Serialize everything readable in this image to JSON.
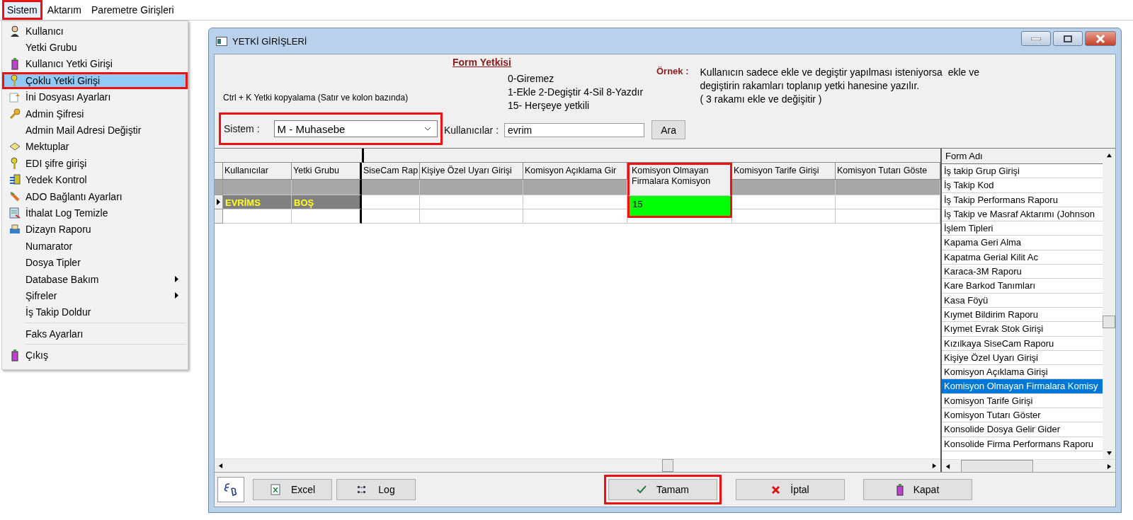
{
  "menubar": [
    {
      "label": "Sistem",
      "selected": true,
      "highlighted": true
    },
    {
      "label": "Aktarım",
      "selected": false,
      "highlighted": false
    },
    {
      "label": "Paremetre Girişleri",
      "selected": false,
      "highlighted": false
    }
  ],
  "menu": [
    {
      "kind": "item",
      "label": "Kullanıcı",
      "selected": false,
      "highlighted": false,
      "submenu": false
    },
    {
      "kind": "item",
      "label": "Yetki Grubu",
      "selected": false,
      "highlighted": false,
      "submenu": false
    },
    {
      "kind": "item",
      "label": "Kullanıcı Yetki Girişi",
      "selected": false,
      "highlighted": false,
      "submenu": false
    },
    {
      "kind": "item",
      "label": "Çoklu Yetki Girişi",
      "selected": true,
      "highlighted": true,
      "submenu": false
    },
    {
      "kind": "item",
      "label": "İni Dosyası  Ayarları",
      "selected": false,
      "highlighted": false,
      "submenu": false
    },
    {
      "kind": "item",
      "label": "Admin Şifresi",
      "selected": false,
      "highlighted": false,
      "submenu": false
    },
    {
      "kind": "item",
      "label": "Admin Mail Adresi Değiştir",
      "selected": false,
      "highlighted": false,
      "submenu": false
    },
    {
      "kind": "item",
      "label": "Mektuplar",
      "selected": false,
      "highlighted": false,
      "submenu": false
    },
    {
      "kind": "item",
      "label": "EDI şifre girişi",
      "selected": false,
      "highlighted": false,
      "submenu": false
    },
    {
      "kind": "item",
      "label": "Yedek Kontrol",
      "selected": false,
      "highlighted": false,
      "submenu": false
    },
    {
      "kind": "item",
      "label": "ADO Bağlantı Ayarları",
      "selected": false,
      "highlighted": false,
      "submenu": false
    },
    {
      "kind": "item",
      "label": "İthalat Log Temizle",
      "selected": false,
      "highlighted": false,
      "submenu": false
    },
    {
      "kind": "item",
      "label": "Dizayn Raporu",
      "selected": false,
      "highlighted": false,
      "submenu": false
    },
    {
      "kind": "item",
      "label": "Numarator",
      "selected": false,
      "highlighted": false,
      "submenu": false
    },
    {
      "kind": "item",
      "label": "Dosya Tipler",
      "selected": false,
      "highlighted": false,
      "submenu": false
    },
    {
      "kind": "item",
      "label": "Database Bakım",
      "selected": false,
      "highlighted": false,
      "submenu": true
    },
    {
      "kind": "item",
      "label": "Şifreler",
      "selected": false,
      "highlighted": false,
      "submenu": true
    },
    {
      "kind": "item",
      "label": "İş Takip Doldur",
      "selected": false,
      "highlighted": false,
      "submenu": false
    },
    {
      "kind": "separator"
    },
    {
      "kind": "item",
      "label": "Faks Ayarları",
      "selected": false,
      "highlighted": false,
      "submenu": false
    },
    {
      "kind": "separator"
    },
    {
      "kind": "item",
      "label": "Çıkış",
      "selected": false,
      "highlighted": false,
      "submenu": false
    }
  ],
  "window": {
    "title": "YETKİ GİRİŞLERİ"
  },
  "info": {
    "hint": "Ctrl + K Yetki kopyalama (Satır ve kolon bazında)",
    "legend_title": "Form Yetkisi",
    "legend": [
      "0-Giremez",
      "1-Ekle  2-Degiştir  4-Sil  8-Yazdır",
      "15- Herşeye yetkili"
    ],
    "example_label": "Örnek :",
    "example": [
      "Kullanıcın sadece ekle ve degiştir yapılması isteniyorsa  ekle ve",
      "degiştirin rakamları toplanıp yetki hanesine yazılır.",
      "( 3 rakamı ekle ve değişitir )"
    ]
  },
  "filters": {
    "system": {
      "label": "Sistem :",
      "value": "M - Muhasebe",
      "highlighted": true
    },
    "users": {
      "label": "Kullanıcılar :",
      "value": "evrim"
    },
    "search_button": "Ara"
  },
  "grid": {
    "fixed_columns": [
      "Kullanıcılar",
      "Yetki Grubu"
    ],
    "columns": [
      {
        "label": "SiseCam Rap",
        "highlighted": false
      },
      {
        "label": "Kişiye Özel Uyarı Girişi",
        "highlighted": false
      },
      {
        "label": "Komisyon Açıklama Gir",
        "highlighted": false
      },
      {
        "label": "Komisyon Olmayan Firmalara Komisyon",
        "highlighted": true
      },
      {
        "label": "Komisyon Tarife Girişi",
        "highlighted": false
      },
      {
        "label": "Komisyon Tutarı Göste",
        "highlighted": false
      }
    ],
    "rows": [
      {
        "user": "EVRİMS",
        "group": "BOŞ",
        "current": true,
        "cells": [
          {
            "filled": false
          },
          {
            "filled": false
          },
          {
            "filled": false
          },
          {
            "filled": true,
            "value": "15"
          },
          {
            "filled": false
          },
          {
            "filled": false
          }
        ]
      }
    ]
  },
  "form_list": {
    "heading": "Form Adı",
    "items": [
      {
        "label": "İş takip Grup Girişi",
        "selected": false
      },
      {
        "label": "İş Takip Kod",
        "selected": false
      },
      {
        "label": "İş Takip Performans Raporu",
        "selected": false
      },
      {
        "label": "İş Takip ve Masraf Aktarımı (Johnson",
        "selected": false
      },
      {
        "label": "İşlem Tipleri",
        "selected": false
      },
      {
        "label": "Kapama Geri Alma",
        "selected": false
      },
      {
        "label": "Kapatma Gerial Kilit Ac",
        "selected": false
      },
      {
        "label": "Karaca-3M Raporu",
        "selected": false
      },
      {
        "label": "Kare Barkod Tanımları",
        "selected": false
      },
      {
        "label": "Kasa Föyü",
        "selected": false
      },
      {
        "label": "Kıymet Bildirim Raporu",
        "selected": false
      },
      {
        "label": "Kıymet Evrak Stok Girişi",
        "selected": false
      },
      {
        "label": "Kızılkaya SiseCam Raporu",
        "selected": false
      },
      {
        "label": "Kişiye Özel Uyarı Girişi",
        "selected": false
      },
      {
        "label": "Komisyon Açıklama Girişi",
        "selected": false
      },
      {
        "label": "Komisyon Olmayan Firmalara Komisy",
        "selected": true
      },
      {
        "label": "Komisyon Tarife Girişi",
        "selected": false
      },
      {
        "label": "Komisyon Tutarı Göster",
        "selected": false
      },
      {
        "label": "Konsolide Dosya Gelir Gider",
        "selected": false
      },
      {
        "label": "Konsolide Firma Performans Raporu",
        "selected": false
      }
    ]
  },
  "buttons": [
    {
      "kind": "excel",
      "label": "Excel",
      "highlighted": false
    },
    {
      "kind": "log",
      "label": "Log",
      "highlighted": false
    },
    {
      "kind": "ok",
      "label": "Tamam",
      "highlighted": true
    },
    {
      "kind": "cancel",
      "label": "İptal",
      "highlighted": false
    },
    {
      "kind": "close",
      "label": "Kapat",
      "highlighted": false
    }
  ]
}
